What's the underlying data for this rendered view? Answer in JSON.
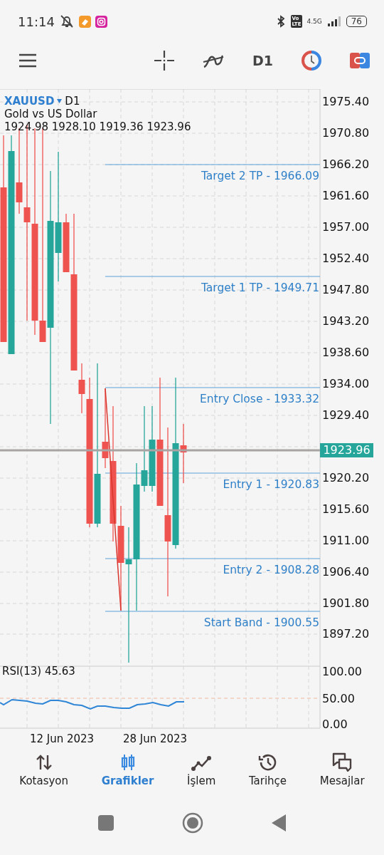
{
  "status_bar": {
    "time": "11:14",
    "volte_top": "Vo",
    "volte_bottom": "LTE",
    "network": "4.5G",
    "battery": "76"
  },
  "toolbar": {
    "timeframe": "D1"
  },
  "chart": {
    "symbol": "XAUUSD",
    "timeframe": "D1",
    "description": "Gold vs US Dollar",
    "ohlc": "1924.98 1928.10 1919.36 1923.96",
    "price_ticks": [
      "1975.40",
      "1970.80",
      "1966.20",
      "1961.60",
      "1957.00",
      "1952.40",
      "1947.80",
      "1943.20",
      "1938.60",
      "1934.00",
      "1929.40",
      "1920.20",
      "1915.60",
      "1911.00",
      "1906.40",
      "1901.80",
      "1897.20"
    ],
    "levels": [
      {
        "label": "Target 2 TP - 1966.09"
      },
      {
        "label": "Target 1 TP - 1949.71"
      },
      {
        "label": "Entry Close - 1933.32"
      },
      {
        "label": "Entry 1 - 1920.83"
      },
      {
        "label": "Entry 2 - 1908.28"
      },
      {
        "label": "Start Band - 1900.55"
      }
    ],
    "current_price": "1923.96",
    "indicator": {
      "label": "RSI(13) 45.63",
      "ticks": [
        "100.00",
        "50.00",
        "0.00"
      ]
    },
    "dates": [
      "12 Jun 2023",
      "28 Jun 2023"
    ]
  },
  "bottom_nav": [
    {
      "label": "Kotasyon",
      "selected": false
    },
    {
      "label": "Grafikler",
      "selected": true
    },
    {
      "label": "İşlem",
      "selected": false
    },
    {
      "label": "Tarihçe",
      "selected": false
    },
    {
      "label": "Mesajlar",
      "selected": false
    }
  ]
}
